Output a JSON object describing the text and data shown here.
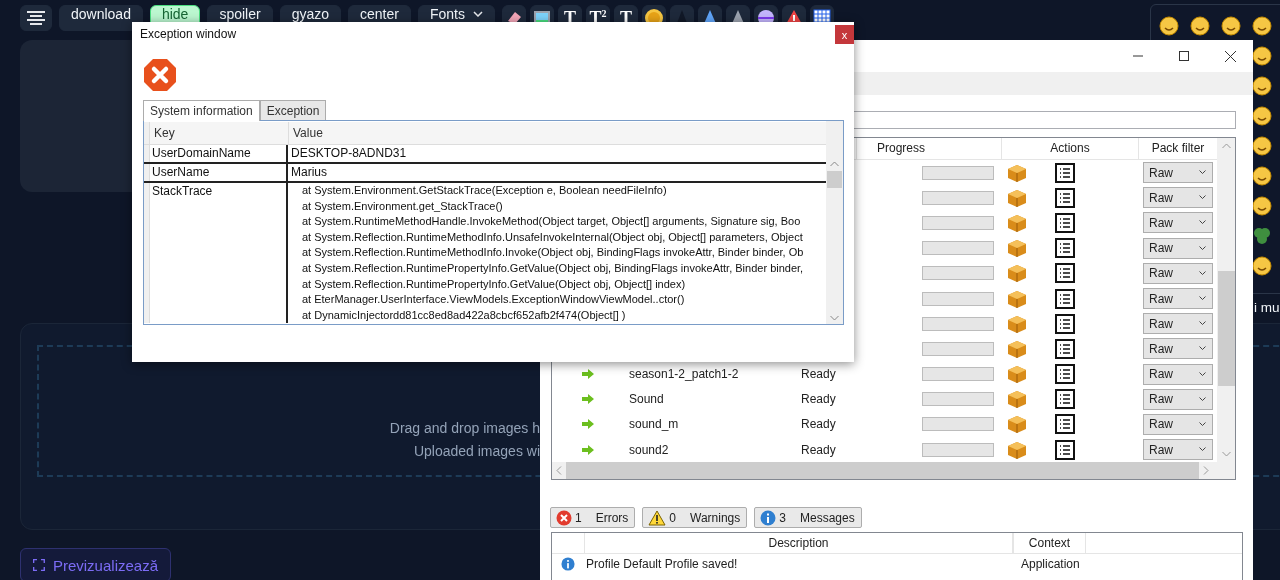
{
  "web_page": {
    "toolbar": [
      {
        "kind": "menu"
      },
      {
        "kind": "text",
        "label": "download",
        "selected": false
      },
      {
        "kind": "text",
        "label": "hide",
        "selected": true
      },
      {
        "kind": "text",
        "label": "spoiler",
        "selected": false
      },
      {
        "kind": "text",
        "label": "gyazo",
        "selected": false
      },
      {
        "kind": "text",
        "label": "center",
        "selected": false
      },
      {
        "kind": "dropdown",
        "label": "Fonts",
        "selected": false
      }
    ],
    "format_buttons": [
      "T",
      "T$^{2}$",
      "T"
    ],
    "drop_zone": [
      "Drag and drop images h",
      "Uploaded images wi"
    ],
    "side_text": "i mu",
    "preview_button": "Previzualizează"
  },
  "app_window": {
    "table": {
      "columns": [
        "Progress",
        "Actions",
        "Pack filter"
      ],
      "rows": [
        {
          "filter": "Raw",
          "level": 0
        },
        {
          "filter": "Raw",
          "level": 0
        },
        {
          "filter": "Raw",
          "level": 0
        },
        {
          "filter": "Raw",
          "level": 0
        },
        {
          "filter": "Raw",
          "level": 0
        },
        {
          "filter": "Raw",
          "level": 0
        },
        {
          "filter": "Raw",
          "level": 0
        },
        {
          "filter": "Raw",
          "level": 0
        },
        {
          "name": "season1-2_patch1-2",
          "status": "Ready",
          "filter": "Raw",
          "level": 0
        },
        {
          "name": "Sound",
          "status": "Ready",
          "filter": "Raw",
          "level": 0
        },
        {
          "name": "sound_m",
          "status": "Ready",
          "filter": "Raw",
          "level": 0
        },
        {
          "name": "sound2",
          "status": "Ready",
          "filter": "Raw",
          "level": 0
        }
      ]
    },
    "log_filters": [
      {
        "kind": "error",
        "count": "1",
        "label": "Errors"
      },
      {
        "kind": "warning",
        "count": "0",
        "label": "Warnings"
      },
      {
        "kind": "info",
        "count": "3",
        "label": "Messages"
      }
    ],
    "messages": {
      "columns": [
        "Description",
        "Context"
      ],
      "rows": [
        {
          "kind": "info",
          "description": "Profile Default Profile saved!",
          "context": "Application"
        }
      ]
    }
  },
  "exception_window": {
    "title": "Exception window",
    "close": "x",
    "tabs": [
      {
        "label": "System information",
        "selected": true
      },
      {
        "label": "Exception",
        "selected": false
      }
    ],
    "grid": {
      "columns": [
        "Key",
        "Value"
      ],
      "rows": [
        {
          "key": "UserDomainName",
          "value": [
            "DESKTOP-8ADND31"
          ]
        },
        {
          "key": "UserName",
          "value": [
            "Marius"
          ]
        },
        {
          "key": "StackTrace",
          "value": [
            "at System.Environment.GetStackTrace(Exception e, Boolean needFileInfo)",
            "at System.Environment.get_StackTrace()",
            "at System.RuntimeMethodHandle.InvokeMethod(Object target, Object[] arguments, Signature sig, Boo",
            "at System.Reflection.RuntimeMethodInfo.UnsafeInvokeInternal(Object obj, Object[] parameters, Object",
            "at System.Reflection.RuntimeMethodInfo.Invoke(Object obj, BindingFlags invokeAttr, Binder binder, Ob",
            "at System.Reflection.RuntimePropertyInfo.GetValue(Object obj, BindingFlags invokeAttr, Binder binder,",
            "at System.Reflection.RuntimePropertyInfo.GetValue(Object obj, Object[] index)",
            "at EterManager.UserInterface.ViewModels.ExceptionWindowViewModel..ctor()",
            "at DynamicInjectordd81cc8ed8ad422a8cbcf652afb2f474(Object[] )"
          ]
        }
      ]
    }
  }
}
